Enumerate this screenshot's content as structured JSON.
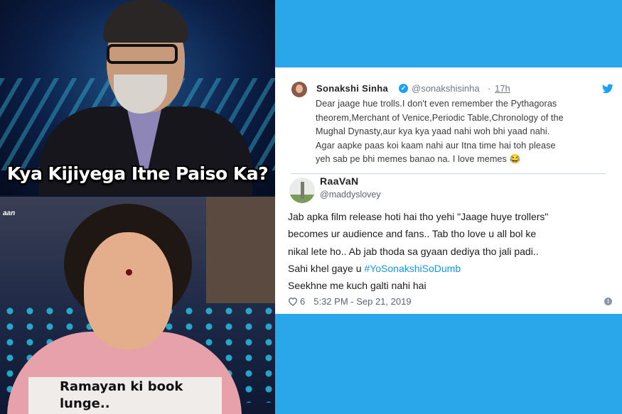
{
  "meme": {
    "top_caption": "Kya Kijiyega Itne Paiso Ka?",
    "channel_tag": "aan",
    "bottom_caption_line1": "Ramayan ki book",
    "bottom_caption_line2": "lunge.."
  },
  "tweet": {
    "author_name": "Sonakshi Sinha",
    "author_handle": "@sonakshisinha",
    "separator": "·",
    "time_ago": "17h",
    "verified_mark": "✓",
    "text_lines": [
      "Dear jaage hue trolls.I don't even remember the Pythagoras",
      "theorem,Merchant of Venice,Periodic Table,Chronology of the",
      "Mughal Dynasty,aur kya kya yaad nahi woh bhi yaad nahi.",
      "Agar aapke paas koi kaam nahi aur Itna time hai toh please",
      "yeh sab pe bhi memes banao na. I love memes 😂"
    ],
    "icon": "twitter-bird-icon"
  },
  "reply": {
    "author_name": "RaaVaN",
    "author_handle": "@maddyslovey",
    "text_lines": [
      "Jab apka film release hoti hai tho yehi \"Jaage huye trollers\"",
      "becomes ur audience and fans.. Tab tho love u all bol ke",
      "nikal lete ho.. Ab jab thoda sa gyaan dediya tho jali padi..",
      "Sahi khel gaye u",
      "Seekhne me kuch galti nahi hai"
    ],
    "hashtag": "#YoSonakshiSoDumb",
    "likes": "6",
    "timestamp": "5:32 PM - Sep 21, 2019",
    "info_mark": "i"
  },
  "colors": {
    "background": "#29a7ea",
    "hashtag": "#1b95e0",
    "verified": "#1da1f2"
  }
}
